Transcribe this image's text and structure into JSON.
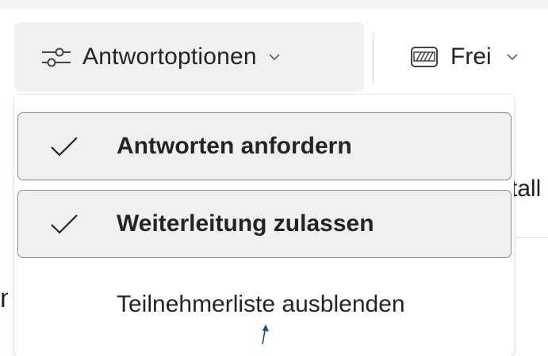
{
  "ribbon": {
    "response_options": {
      "label": "Antwortoptionen",
      "icon": "sliders-icon",
      "chevron": "chevron-down-icon"
    },
    "status": {
      "label": "Frei",
      "icon": "free-busy-icon",
      "chevron": "chevron-down-icon"
    }
  },
  "background": {
    "right_text": "tall",
    "left_glyph": "n"
  },
  "menu": {
    "items": [
      {
        "label": "Antworten anfordern",
        "checked": true,
        "icon": "checkmark-icon"
      },
      {
        "label": "Weiterleitung zulassen",
        "checked": true,
        "icon": "checkmark-icon"
      },
      {
        "label": "Teilnehmerliste ausblenden",
        "checked": false
      }
    ]
  },
  "colors": {
    "checked_bg": "#f0f0f0",
    "checked_border": "#8a8a8a",
    "text": "#242424",
    "cursor": "#1f4e6e"
  }
}
